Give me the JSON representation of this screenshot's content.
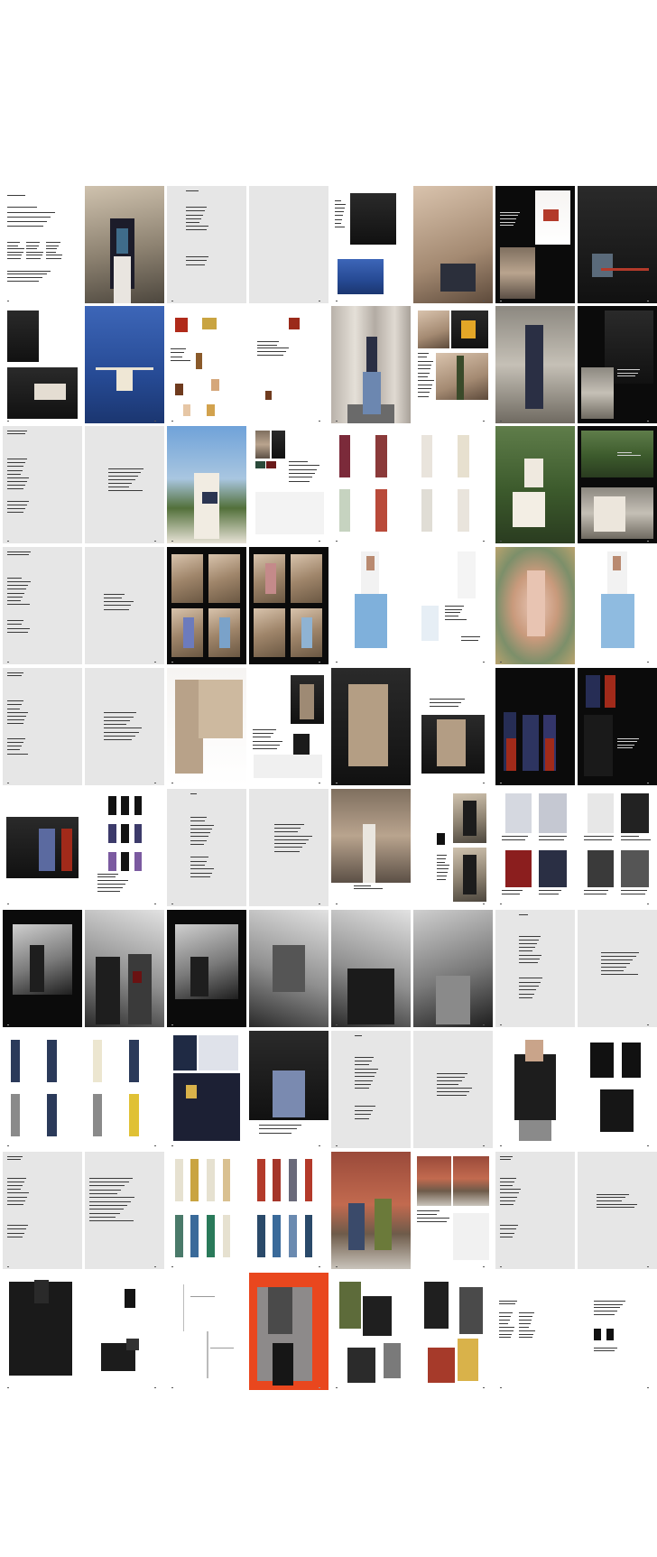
{
  "document": {
    "page_numbers": {
      "p1": "2",
      "p1b": "3",
      "p3": "4",
      "p3b": "5",
      "p4": "6",
      "p5": "7",
      "p6": "8"
    }
  },
  "colors": {
    "page_gray": "#e6e6e6",
    "page_black": "#0b0b0b",
    "accent_red": "#e9471e"
  }
}
